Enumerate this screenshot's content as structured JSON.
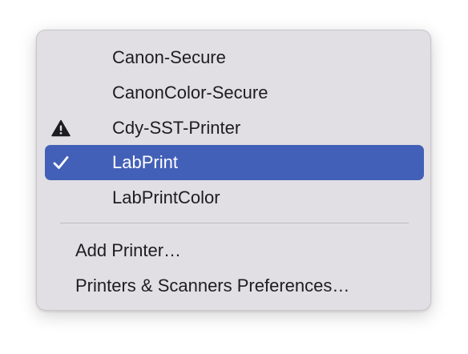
{
  "menu": {
    "printers": [
      {
        "label": "Canon-Secure",
        "selected": false,
        "warning": false
      },
      {
        "label": "CanonColor-Secure",
        "selected": false,
        "warning": false
      },
      {
        "label": "Cdy-SST-Printer",
        "selected": false,
        "warning": true
      },
      {
        "label": "LabPrint",
        "selected": true,
        "warning": false
      },
      {
        "label": "LabPrintColor",
        "selected": false,
        "warning": false
      }
    ],
    "actions": [
      {
        "label": "Add Printer…"
      },
      {
        "label": "Printers & Scanners Preferences…"
      }
    ],
    "selection_color": "#4360b8",
    "warning_icon": "warning-triangle-icon",
    "check_icon": "checkmark-icon"
  }
}
